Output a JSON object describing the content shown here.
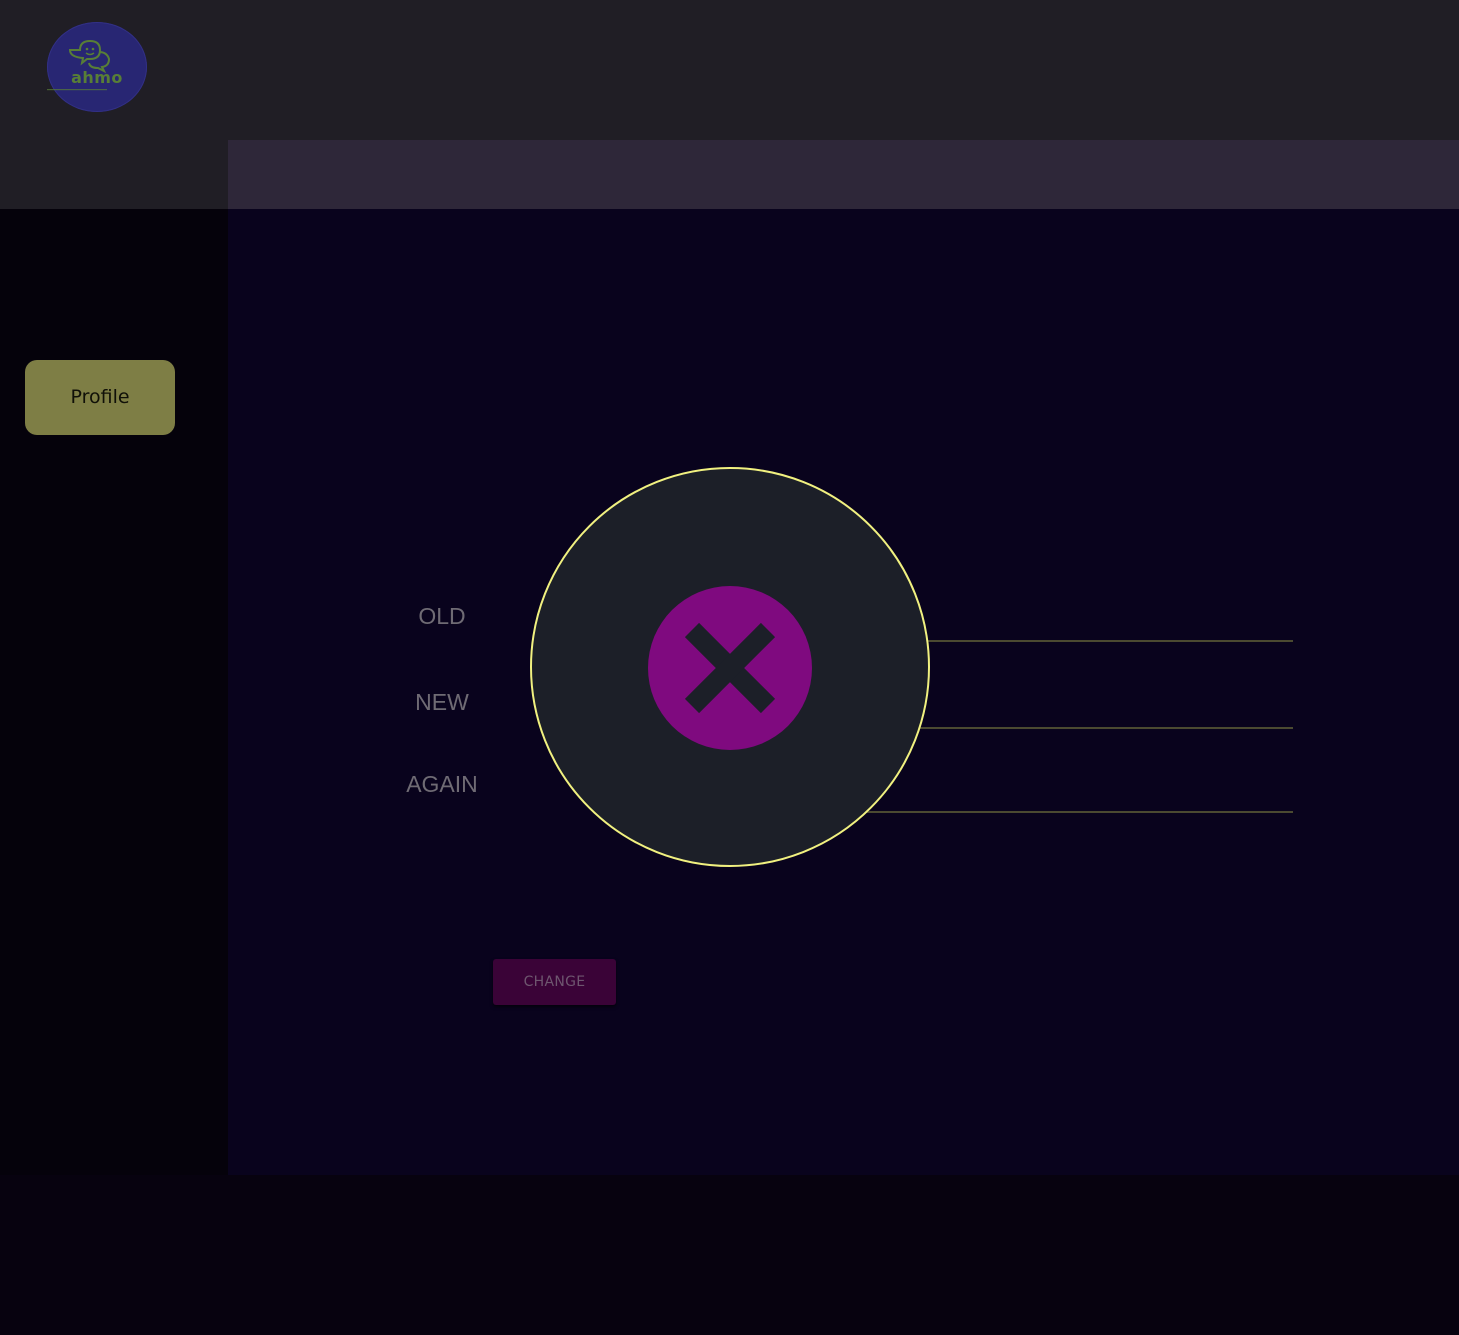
{
  "header": {
    "logo": {
      "wordmark": "ahmo",
      "icon": "chat-bubbles-icon",
      "colors": {
        "background": "#282673",
        "mark": "#587e36"
      }
    }
  },
  "sidebar": {
    "items": [
      {
        "label": "Profile"
      }
    ]
  },
  "form": {
    "fields": [
      {
        "label": "OLD"
      },
      {
        "label": "NEW"
      },
      {
        "label": "AGAIN"
      }
    ],
    "submit_label": "CHANGE"
  },
  "overlay": {
    "icon": "error-x-icon",
    "colors": {
      "ring": "#f1f180",
      "badge": "#7f0a7f",
      "panel": "#1c1f28"
    }
  }
}
